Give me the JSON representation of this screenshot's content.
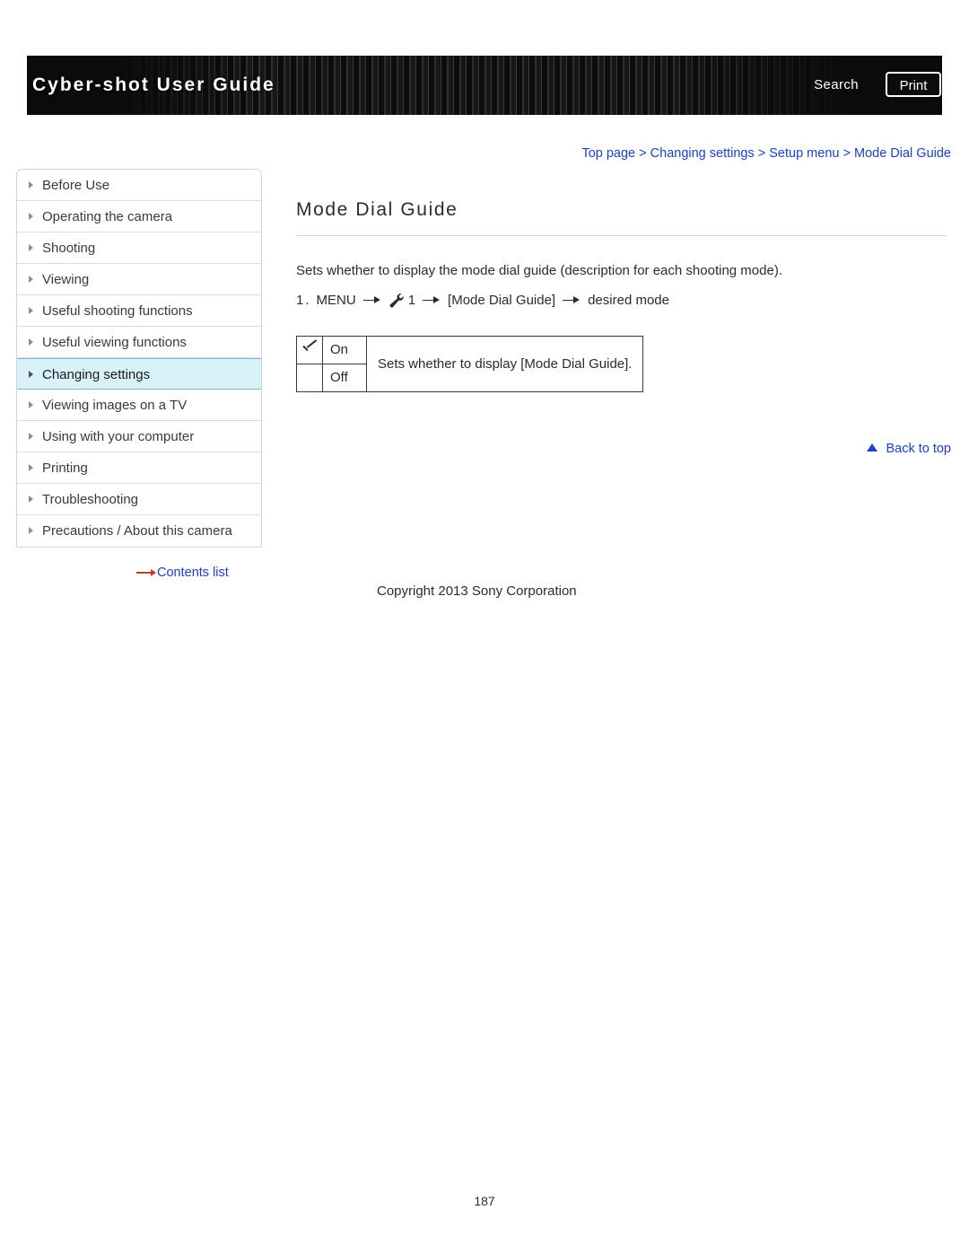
{
  "header": {
    "title": "Cyber-shot User Guide",
    "search_label": "Search",
    "print_label": "Print"
  },
  "breadcrumb": {
    "items": [
      "Top page",
      "Changing settings",
      "Setup menu",
      "Mode Dial Guide"
    ],
    "separator": ">",
    "text": "Top page > Changing settings > Setup menu > Mode Dial Guide"
  },
  "sidebar": {
    "items": [
      {
        "label": "Before Use"
      },
      {
        "label": "Operating the camera"
      },
      {
        "label": "Shooting"
      },
      {
        "label": "Viewing"
      },
      {
        "label": "Useful shooting functions"
      },
      {
        "label": "Useful viewing functions"
      },
      {
        "label": "Changing settings"
      },
      {
        "label": "Viewing images on a TV"
      },
      {
        "label": "Using with your computer"
      },
      {
        "label": "Printing"
      },
      {
        "label": "Troubleshooting"
      },
      {
        "label": "Precautions / About this camera"
      }
    ],
    "active_index": 6,
    "contents_list_label": "Contents list"
  },
  "main": {
    "title": "Mode Dial Guide",
    "intro": "Sets whether to display the mode dial guide (description for each shooting mode).",
    "step": {
      "number": "1.",
      "part1": "MENU",
      "part2": "1",
      "part3": "[Mode Dial Guide]",
      "part4": "desired mode"
    },
    "options": {
      "rows": [
        {
          "checked": true,
          "label": "On"
        },
        {
          "checked": false,
          "label": "Off"
        }
      ],
      "description": "Sets whether to display [Mode Dial Guide]."
    },
    "back_to_top": "Back to top"
  },
  "footer": {
    "copyright": "Copyright 2013 Sony Corporation",
    "page_number": "187"
  }
}
